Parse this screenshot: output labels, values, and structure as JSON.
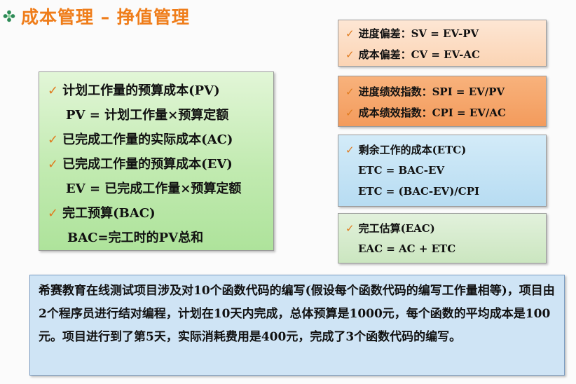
{
  "title": "成本管理 – 挣值管理",
  "icons": {
    "title": "flower-bullet-icon",
    "bullet": "check-mark-icon"
  },
  "colors": {
    "title": "#ef7d1a",
    "check": "#e07b1e"
  },
  "left_box": {
    "pv_label": "计划工作量的预算成本(PV)",
    "pv_formula": "PV = 计划工作量×预算定额",
    "ac_label": "已完成工作量的实际成本(AC)",
    "ev_label": "已完成工作量的预算成本(EV)",
    "ev_formula": "EV = 已完成工作量×预算定额",
    "bac_label": "完工预算(BAC)",
    "bac_formula": "BAC=完工时的PV总和"
  },
  "variance_box": {
    "sv": "进度偏差：SV = EV-PV",
    "cv": "成本偏差：CV = EV-AC"
  },
  "index_box": {
    "spi": "进度绩效指数：SPI = EV/PV",
    "cpi": "成本绩效指数：CPI = EV/AC"
  },
  "etc_box": {
    "label": "剩余工作的成本(ETC)",
    "formula1": "ETC = BAC-EV",
    "formula2": "ETC = (BAC-EV)/CPI"
  },
  "eac_box": {
    "label": "完工估算(EAC)",
    "formula": "EAC = AC + ETC"
  },
  "problem": {
    "text": "希赛教育在线测试项目涉及对10个函数代码的编写(假设每个函数代码的编写工作量相等)，项目由2个程序员进行结对编程，计划在10天内完成，总体预算是1000元，每个函数的平均成本是100元。项目进行到了第5天，实际消耗费用是400元，完成了3个函数代码的编写。"
  }
}
